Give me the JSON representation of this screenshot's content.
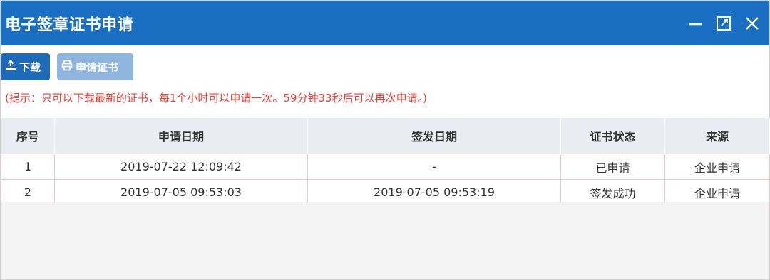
{
  "window": {
    "title": "电子签章证书申请"
  },
  "toolbar": {
    "download_label": "下载",
    "apply_label": "申请证书"
  },
  "hint": "(提示：只可以下载最新的证书，每1个小时可以申请一次。59分钟33秒后可以再次申请。)",
  "table": {
    "columns": [
      "序号",
      "申请日期",
      "签发日期",
      "证书状态",
      "来源"
    ],
    "rows": [
      [
        "1",
        "2019-07-22 12:09:42",
        "-",
        "已申请",
        "企业申请"
      ],
      [
        "2",
        "2019-07-05 09:53:03",
        "2019-07-05 09:53:19",
        "签发成功",
        "企业申请"
      ]
    ]
  },
  "colors": {
    "titlebar": "#1a6fc2",
    "primary_button": "#1c6ab8",
    "disabled_button": "#8fb4de",
    "hint_text": "#e8413a"
  }
}
